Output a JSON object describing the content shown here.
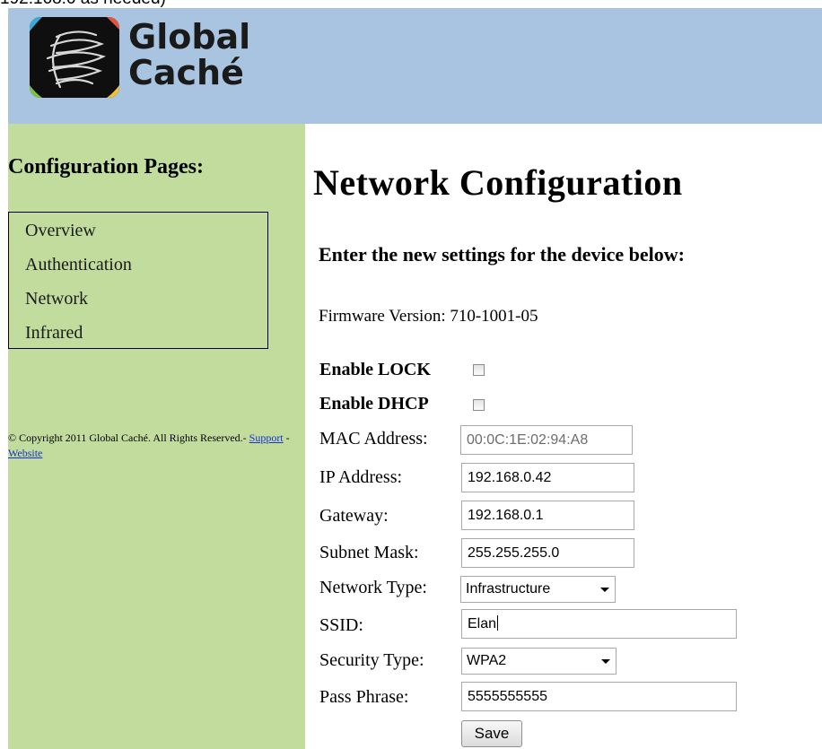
{
  "caption": "192.168.0 as needed)",
  "header": {
    "logo_line1": "Global",
    "logo_line2": "Caché",
    "bg_color": "#a8c4e0",
    "logo_icon": "globe-icon"
  },
  "sidebar": {
    "heading": "Configuration Pages:",
    "items": [
      {
        "label": "Overview"
      },
      {
        "label": "Authentication"
      },
      {
        "label": "Network"
      },
      {
        "label": "Infrared"
      }
    ],
    "copyright_text": "© Copyright 2011 Global Caché. All Rights Reserved.-",
    "support_link": "Support",
    "separator": "-",
    "website_link": "Website",
    "bg_color": "#c2dc9d"
  },
  "main": {
    "title": "Network Configuration",
    "subtitle": "Enter the new settings for the device below:",
    "firmware": "Firmware Version: 710-1001-05",
    "form": {
      "lock_label": "Enable LOCK",
      "lock_checked": false,
      "dhcp_label": "Enable DHCP",
      "dhcp_checked": false,
      "mac_label": "MAC Address:",
      "mac_value": "00:0C:1E:02:94:A8",
      "ip_label": "IP Address:",
      "ip_value": "192.168.0.42",
      "gateway_label": "Gateway:",
      "gateway_value": "192.168.0.1",
      "subnet_label": "Subnet Mask:",
      "subnet_value": "255.255.255.0",
      "nettype_label": "Network Type:",
      "nettype_value": "Infrastructure",
      "ssid_label": "SSID:",
      "ssid_value": "Elan",
      "security_label": "Security Type:",
      "security_value": "WPA2",
      "pass_label": "Pass Phrase:",
      "pass_value": "5555555555",
      "save_label": "Save"
    }
  }
}
